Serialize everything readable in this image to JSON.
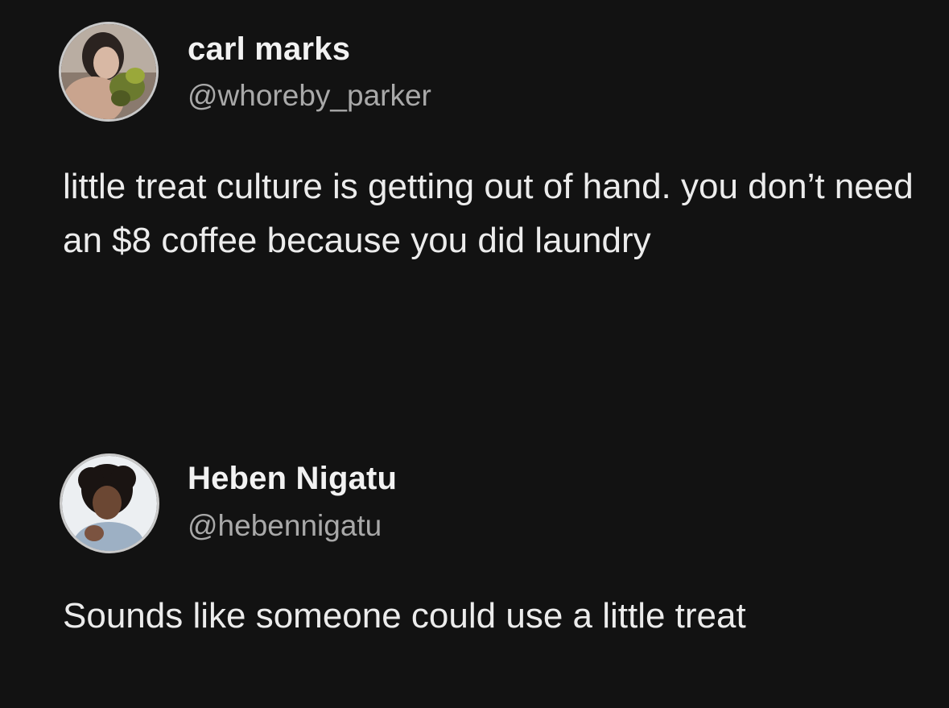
{
  "posts": [
    {
      "display_name": "carl marks",
      "handle": "@whoreby_parker",
      "avatar_icon": "profile-photo-icon",
      "text": "little treat culture is getting out of hand. you don’t need an $8 coffee because you did laundry"
    },
    {
      "display_name": "Heben Nigatu",
      "handle": "@hebennigatu",
      "avatar_icon": "profile-photo-icon",
      "text": "Sounds like someone could use a little treat"
    }
  ],
  "colors": {
    "background": "#121212",
    "name": "#f2f2f2",
    "handle": "#a9a9a9",
    "body": "#ececec"
  }
}
